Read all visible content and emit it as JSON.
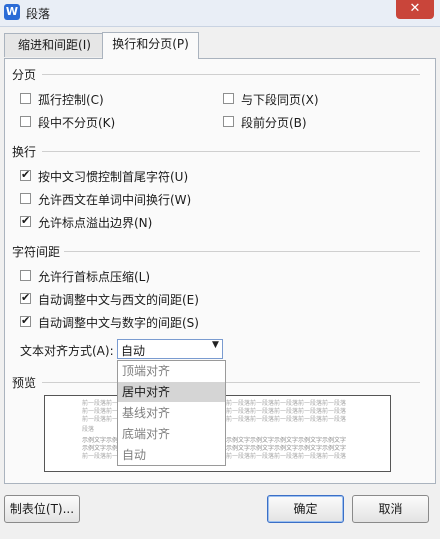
{
  "window": {
    "title": "段落",
    "app_icon": "W"
  },
  "tabs": [
    {
      "label": "缩进和间距(I)"
    },
    {
      "label": "换行和分页(P)"
    }
  ],
  "pagination": {
    "title": "分页",
    "widow_control": "孤行控制(C)",
    "keep_with_next": "与下段同页(X)",
    "keep_lines": "段中不分页(K)",
    "page_break_before": "段前分页(B)"
  },
  "line_break": {
    "title": "换行",
    "chinese_rules": "按中文习惯控制首尾字符(U)",
    "word_wrap": "允许西文在单词中间换行(W)",
    "hanging_punct": "允许标点溢出边界(N)"
  },
  "char_spacing": {
    "title": "字符间距",
    "compress_punct": "允许行首标点压缩(L)",
    "auto_cn_west": "自动调整中文与西文的间距(E)",
    "auto_cn_num": "自动调整中文与数字的间距(S)",
    "align_label": "文本对齐方式(A):",
    "align_value": "自动",
    "options": [
      "顶端对齐",
      "居中对齐",
      "基线对齐",
      "底端对齐",
      "自动"
    ]
  },
  "preview": {
    "title": "预览",
    "prev_line": "前一段落前一段落前一段落前一段落前一段落前一段落前一段落前一段落前一段落前一段落前一段落",
    "prev_line_short": "段落",
    "sample_line": "示例文字示例文字示例文字示例文字示例文字示例文字示例文字示例文字示例文字示例文字示例文字"
  },
  "buttons": {
    "tabs": "制表位(T)...",
    "ok": "确定",
    "cancel": "取消"
  }
}
